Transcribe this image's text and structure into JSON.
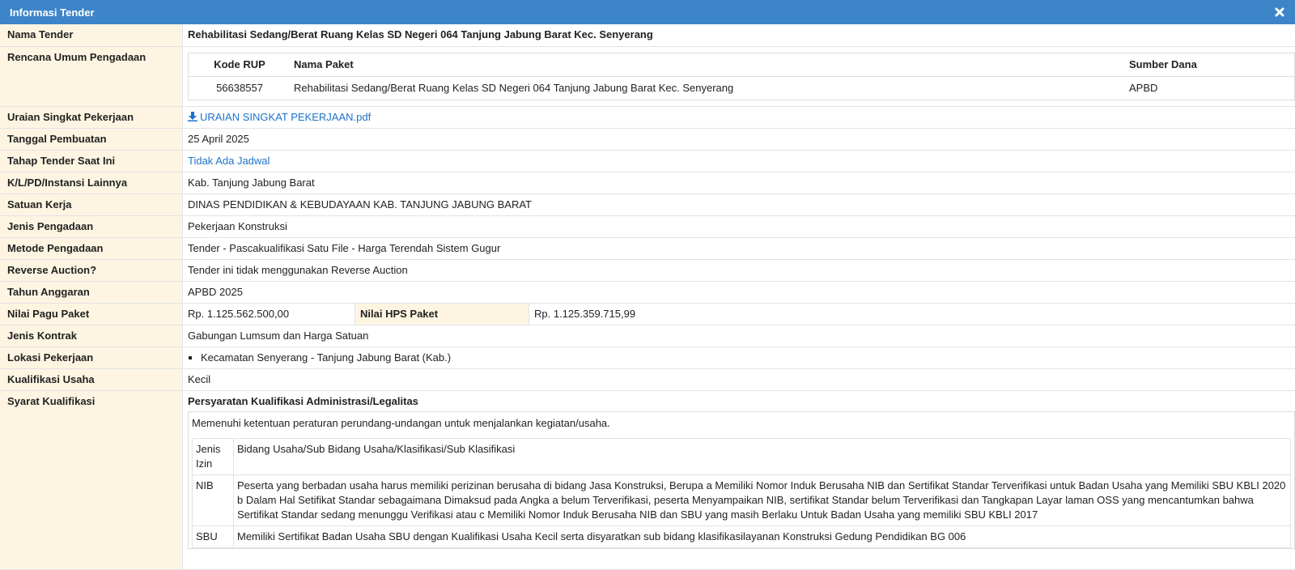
{
  "window": {
    "title": "Informasi Tender"
  },
  "colors": {
    "header_bg": "#3d85c9",
    "label_bg": "#fdf5e2",
    "link": "#1e73c9"
  },
  "fields": {
    "nama_tender": {
      "label": "Nama Tender",
      "value": "Rehabilitasi Sedang/Berat Ruang Kelas SD Negeri 064 Tanjung Jabung Barat Kec. Senyerang"
    },
    "rup": {
      "label": "Rencana Umum Pengadaan",
      "headers": {
        "kode": "Kode RUP",
        "nama": "Nama Paket",
        "sumber": "Sumber Dana"
      },
      "rows": [
        {
          "kode": "56638557",
          "nama": "Rehabilitasi Sedang/Berat Ruang Kelas SD Negeri 064 Tanjung Jabung Barat Kec. Senyerang",
          "sumber": "APBD"
        }
      ]
    },
    "uraian": {
      "label": "Uraian Singkat Pekerjaan",
      "value": "URAIAN SINGKAT PEKERJAAN.pdf",
      "icon": "download-icon"
    },
    "tanggal": {
      "label": "Tanggal Pembuatan",
      "value": "25 April 2025"
    },
    "tahap": {
      "label": "Tahap Tender Saat Ini",
      "value": "Tidak Ada Jadwal"
    },
    "klpd": {
      "label": "K/L/PD/Instansi Lainnya",
      "value": "Kab. Tanjung Jabung Barat"
    },
    "satker": {
      "label": "Satuan Kerja",
      "value": "DINAS PENDIDIKAN & KEBUDAYAAN KAB. TANJUNG JABUNG BARAT"
    },
    "jenis_pengadaan": {
      "label": "Jenis Pengadaan",
      "value": "Pekerjaan Konstruksi"
    },
    "metode": {
      "label": "Metode Pengadaan",
      "value": "Tender - Pascakualifikasi Satu File - Harga Terendah Sistem Gugur"
    },
    "reverse": {
      "label": "Reverse Auction?",
      "value": "Tender ini tidak menggunakan Reverse Auction"
    },
    "tahun": {
      "label": "Tahun Anggaran",
      "value": "APBD 2025"
    },
    "pagu": {
      "label": "Nilai Pagu Paket",
      "value": "Rp. 1.125.562.500,00",
      "hps_label": "Nilai HPS Paket",
      "hps_value": "Rp. 1.125.359.715,99"
    },
    "kontrak": {
      "label": "Jenis Kontrak",
      "value": "Gabungan Lumsum dan Harga Satuan"
    },
    "lokasi": {
      "label": "Lokasi Pekerjaan",
      "items": [
        "Kecamatan Senyerang - Tanjung Jabung Barat (Kab.)"
      ]
    },
    "kualifikasi": {
      "label": "Kualifikasi Usaha",
      "value": "Kecil"
    },
    "syarat": {
      "label": "Syarat Kualifikasi",
      "title": "Persyaratan Kualifikasi Administrasi/Legalitas",
      "intro": "Memenuhi ketentuan peraturan perundang-undangan untuk menjalankan kegiatan/usaha.",
      "izin": [
        {
          "k": "Jenis Izin",
          "v": "Bidang Usaha/Sub Bidang Usaha/Klasifikasi/Sub Klasifikasi"
        },
        {
          "k": "NIB",
          "v": "Peserta yang berbadan usaha harus memiliki perizinan berusaha di bidang Jasa Konstruksi, Berupa a Memiliki Nomor Induk Berusaha NIB dan Sertifikat Standar Terverifikasi untuk Badan Usaha yang Memiliki SBU KBLI 2020 b Dalam Hal Setifikat Standar sebagaimana Dimaksud pada Angka a belum Terverifikasi, peserta Menyampaikan NIB, sertifikat Standar belum Terverifikasi dan Tangkapan Layar laman OSS yang mencantumkan bahwa Sertifikat Standar sedang menunggu Verifikasi atau c Memiliki Nomor Induk Berusaha NIB dan SBU yang masih Berlaku Untuk Badan Usaha yang memiliki SBU KBLI 2017"
        },
        {
          "k": "SBU",
          "v": "Memiliki Sertifikat Badan Usaha SBU dengan Kualifikasi Usaha Kecil serta disyaratkan sub bidang klasifikasilayanan Konstruksi Gedung Pendidikan BG 006"
        }
      ]
    }
  }
}
